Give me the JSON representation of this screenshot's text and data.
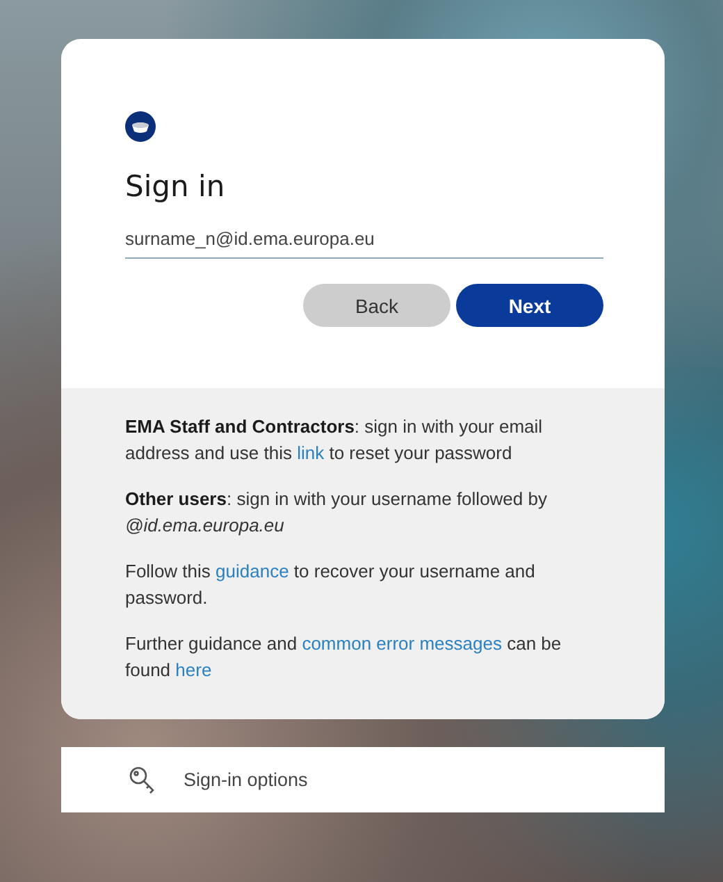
{
  "title": "Sign in",
  "email_field": {
    "value": "surname_n@id.ema.europa.eu"
  },
  "buttons": [
    {
      "label": "Back",
      "kind": "secondary"
    },
    {
      "label": "Next",
      "kind": "primary"
    }
  ],
  "info": [
    [
      {
        "kind": "bold",
        "text": "EMA Staff and Contractors"
      },
      {
        "kind": "text",
        "text": ": sign in with your email address and use this "
      },
      {
        "kind": "link",
        "text": "link"
      },
      {
        "kind": "text",
        "text": " to reset your password"
      }
    ],
    [
      {
        "kind": "bold",
        "text": "Other users"
      },
      {
        "kind": "text",
        "text": ": sign in with your username followed by "
      },
      {
        "kind": "italic",
        "text": "@id.ema.europa.eu"
      }
    ],
    [
      {
        "kind": "text",
        "text": "Follow this "
      },
      {
        "kind": "link",
        "text": "guidance"
      },
      {
        "kind": "text",
        "text": " to recover your username and password."
      }
    ],
    [
      {
        "kind": "text",
        "text": "Further guidance and "
      },
      {
        "kind": "link",
        "text": "common error messages"
      },
      {
        "kind": "text",
        "text": " can be found "
      },
      {
        "kind": "link",
        "text": "here"
      }
    ]
  ],
  "sign_in_options": {
    "label": "Sign-in options"
  }
}
